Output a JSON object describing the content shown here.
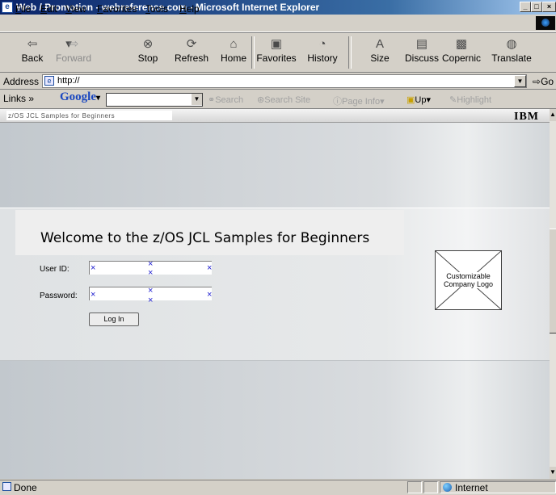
{
  "window": {
    "title": "Web / Promotion - webreference.com - Microsoft Internet Explorer",
    "buttons": [
      "_",
      "□",
      "×"
    ]
  },
  "menu": [
    "File",
    "Edit",
    "View",
    "Favorites",
    "Tools",
    "Help"
  ],
  "toolbar": [
    {
      "label": "Back",
      "icon": "back-arrow-icon",
      "glyph": "⇦",
      "enabled": true
    },
    {
      "label": "Forward",
      "icon": "forward-arrow-icon",
      "glyph": "⇨",
      "enabled": false
    },
    {
      "label": "Stop",
      "icon": "stop-icon",
      "glyph": "⊗",
      "enabled": true
    },
    {
      "label": "Refresh",
      "icon": "refresh-icon",
      "glyph": "⟳",
      "enabled": true
    },
    {
      "label": "Home",
      "icon": "home-icon",
      "glyph": "⌂",
      "enabled": true
    },
    {
      "label": "Favorites",
      "icon": "favorites-icon",
      "glyph": "▣",
      "enabled": true
    },
    {
      "label": "History",
      "icon": "history-icon",
      "glyph": "◔",
      "enabled": true
    },
    {
      "label": "Size",
      "icon": "size-icon",
      "glyph": "A",
      "enabled": true
    },
    {
      "label": "Discuss",
      "icon": "discuss-icon",
      "glyph": "▤",
      "enabled": true
    },
    {
      "label": "Copernic",
      "icon": "copernic-icon",
      "glyph": "▩",
      "enabled": true
    },
    {
      "label": "Translate",
      "icon": "translate-icon",
      "glyph": "◍",
      "enabled": true
    }
  ],
  "address": {
    "label": "Address",
    "value": "http://",
    "go_label": "Go"
  },
  "links_bar": {
    "label": "Links »",
    "google_logo": "Google",
    "tools": [
      "Search",
      "Search Site",
      "Page Info",
      "Up",
      "Highlight"
    ]
  },
  "page": {
    "header_label": "z/OS JCL Samples for Beginners",
    "brand": "IBM",
    "welcome": "Welcome to the z/OS JCL Samples for Beginners",
    "user_label": "User ID:",
    "password_label": "Password:",
    "login_label": "Log In",
    "logo_placeholder_line1": "Customizable",
    "logo_placeholder_line2": "Company Logo"
  },
  "status": {
    "text": "Done",
    "zone": "Internet"
  }
}
